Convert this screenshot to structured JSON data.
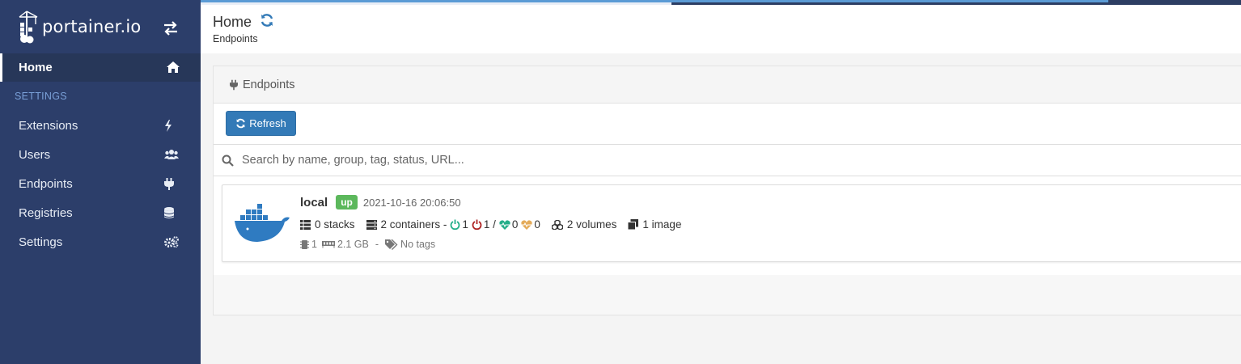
{
  "brand": {
    "name": "portainer.io"
  },
  "sidebar": {
    "home_label": "Home",
    "section_title": "SETTINGS",
    "items": [
      {
        "label": "Extensions",
        "icon": "bolt-icon"
      },
      {
        "label": "Users",
        "icon": "users-icon"
      },
      {
        "label": "Endpoints",
        "icon": "plug-icon"
      },
      {
        "label": "Registries",
        "icon": "database-icon"
      },
      {
        "label": "Settings",
        "icon": "cogs-icon"
      }
    ]
  },
  "header": {
    "title": "Home",
    "breadcrumb": "Endpoints"
  },
  "widget": {
    "title": "Endpoints",
    "refresh_label": "Refresh",
    "search_placeholder": "Search by name, group, tag, status, URL..."
  },
  "endpoint": {
    "name": "local",
    "status": "up",
    "timestamp": "2021-10-16 20:06:50",
    "stacks": "0 stacks",
    "containers": "2 containers -",
    "running": "1",
    "stopped": "1 /",
    "healthy": "0",
    "unhealthy": "0",
    "volumes": "2 volumes",
    "images": "1 image",
    "cpu": "1",
    "memory": "2.1 GB",
    "separator": "-",
    "tags": "No tags"
  },
  "colors": {
    "sidebar_bg": "#2c3e6a",
    "accent": "#337ab7",
    "status_up": "#5cb85c",
    "running": "#23ae89",
    "stopped": "#ae2323",
    "unhealthy": "#e4ab59"
  }
}
